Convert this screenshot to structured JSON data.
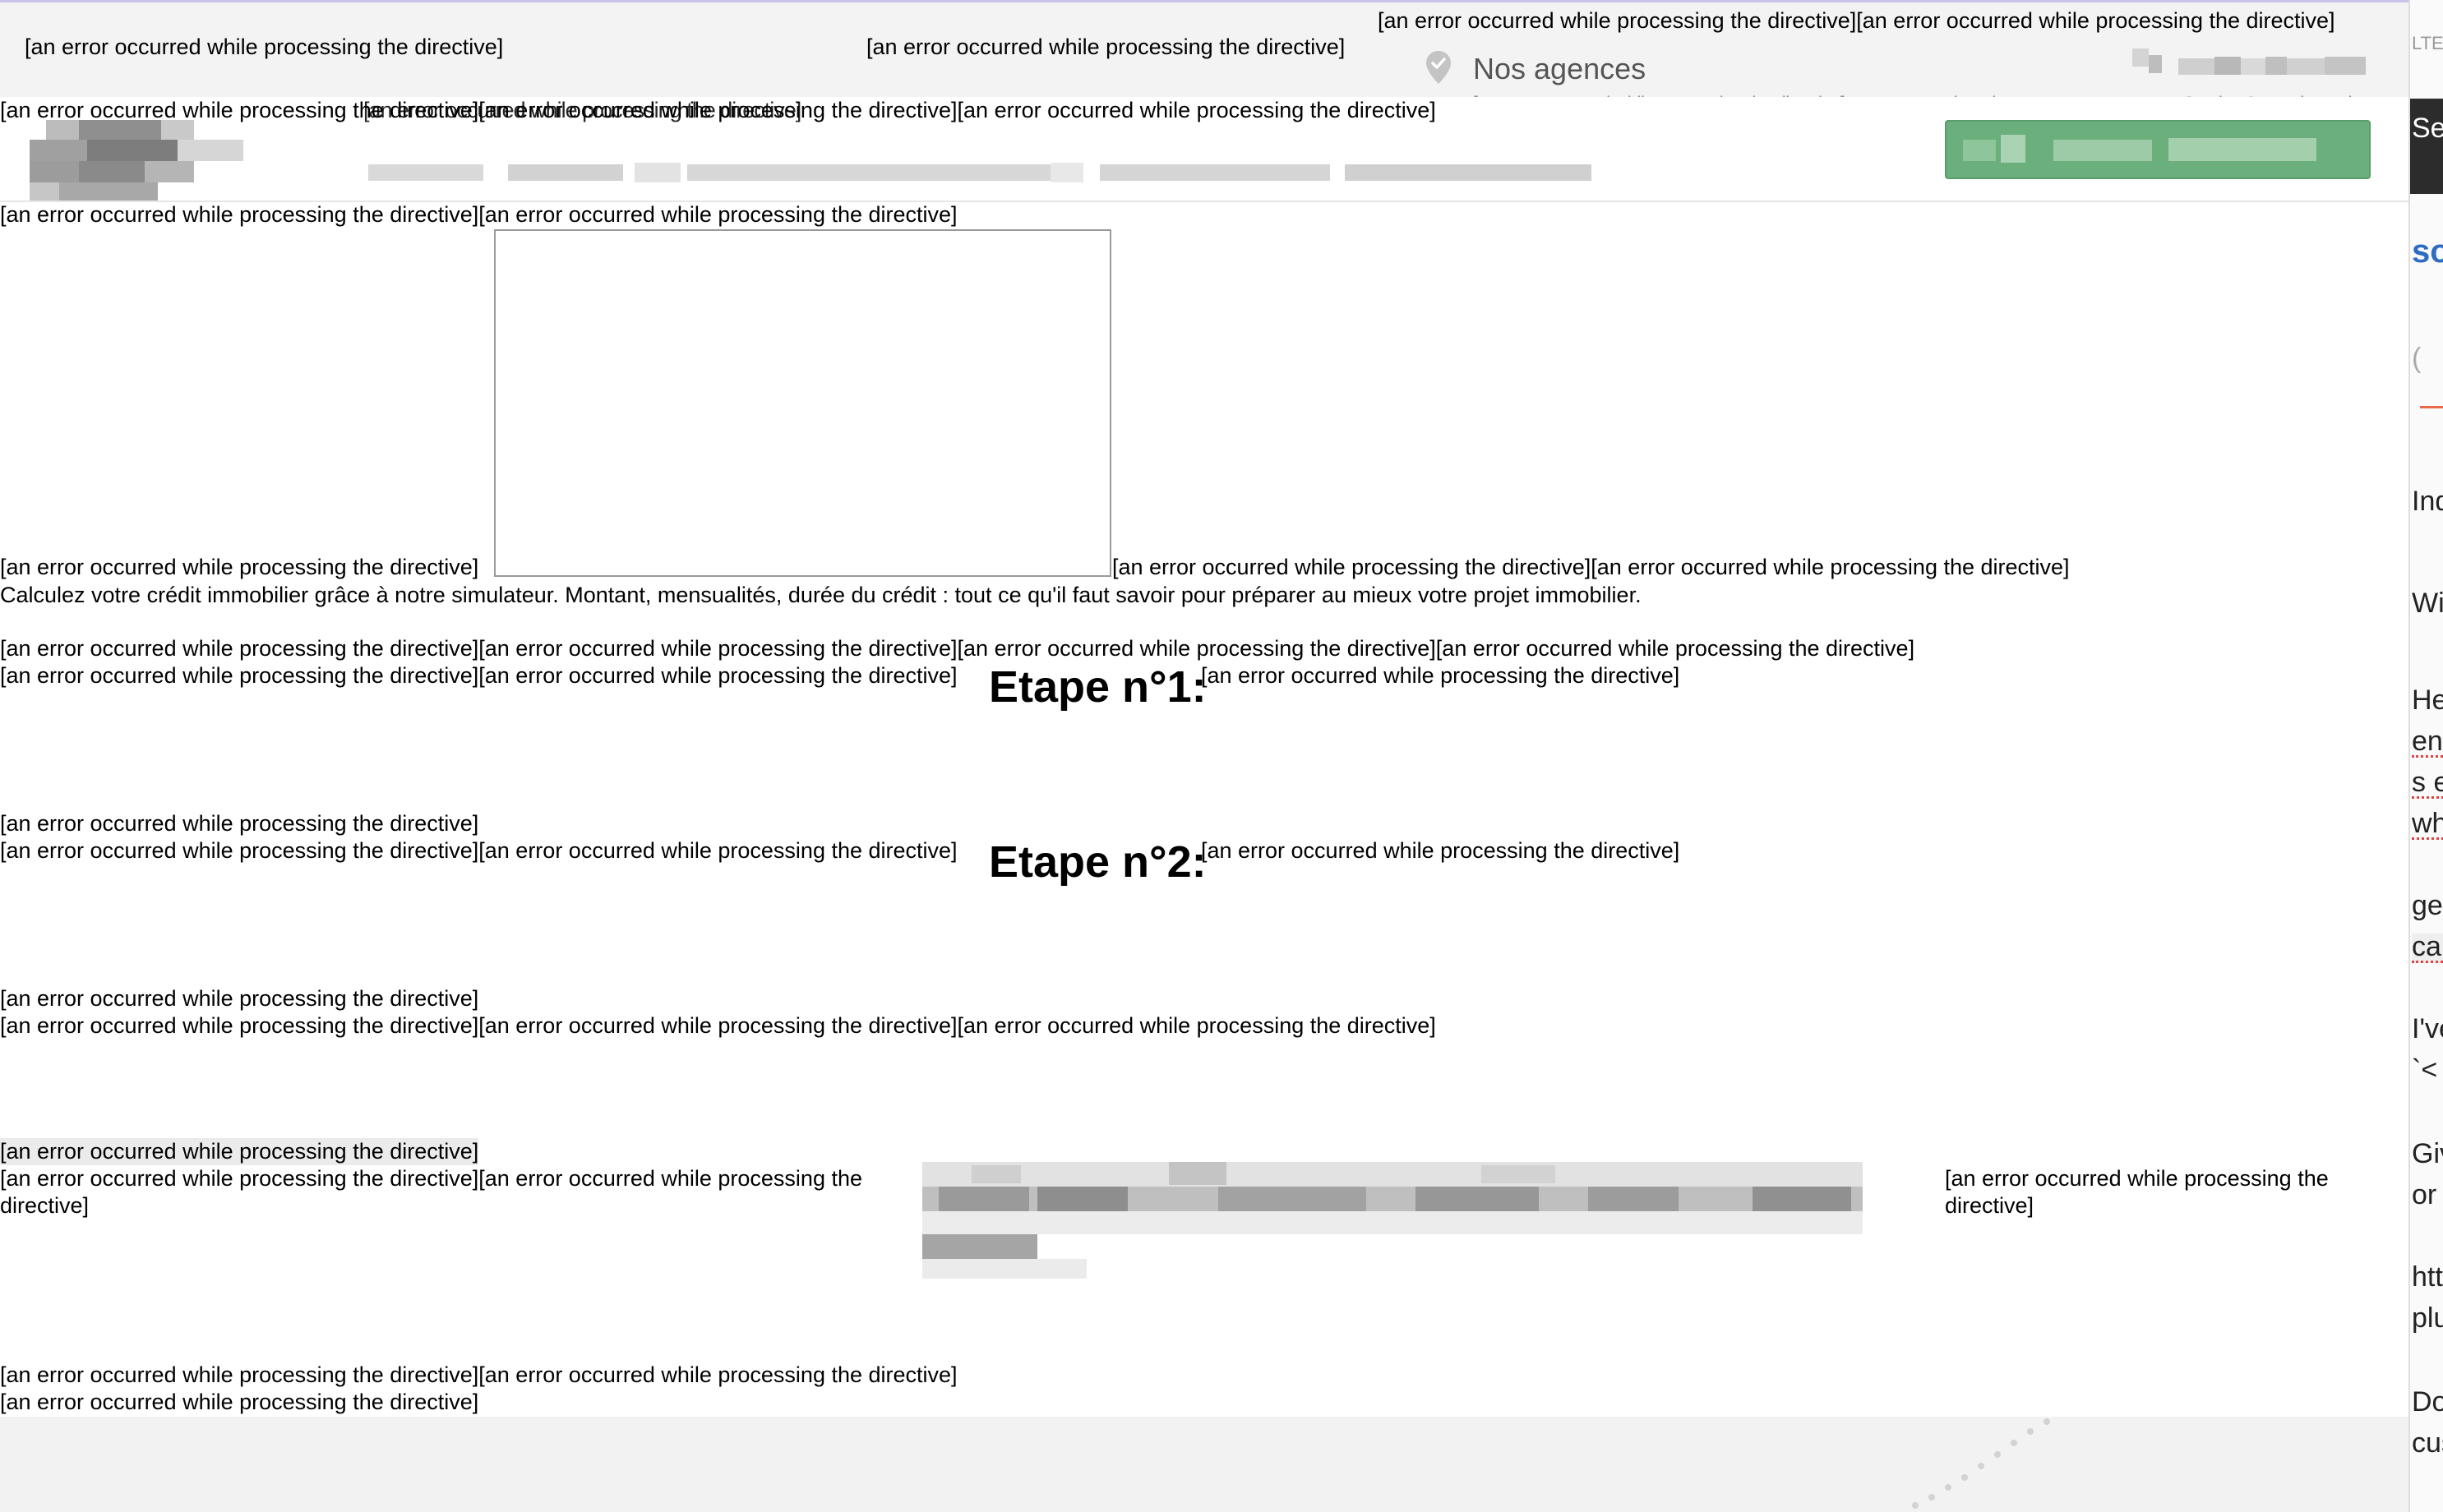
{
  "error_text": "[an error occurred while processing the directive]",
  "header": {
    "top_errors": {
      "left": "[an error occurred while processing the directive]",
      "center": "[an error occurred while processing the directive]",
      "right_pair": "[an error occurred while processing the directive][an error occurred while processing the directive]"
    },
    "agences": {
      "title": "Nos agences",
      "subtitle": "[an error occurred while processing the directive] agences proches de vous"
    },
    "service": {
      "subtitle": "Service & appel gratuit"
    },
    "nav_errors_line": "[an error occurred while processing the directive][an error occurred while processing the directive][an error occurred while processing the directive]",
    "nav_overlap_fragment": "[an error occurred while processing the directive]"
  },
  "content": {
    "row1": "[an error occurred while processing the directive][an error occurred while processing the directive]",
    "row2_left": "[an error occurred while processing the directive]",
    "row2_right": "[an error occurred while processing the directive][an error occurred while processing the directive]",
    "description": "Calculez votre crédit immobilier grâce à notre simulateur. Montant, mensualités, durée du crédit : tout ce qu'il faut savoir pour préparer au mieux votre projet immobilier.",
    "row3": "[an error occurred while processing the directive][an error occurred while processing the directive][an error occurred while processing the directive][an error occurred while processing the directive]",
    "step1": {
      "prefix": "[an error occurred while processing the directive][an error occurred while processing the directive]",
      "title": "Etape n°1:",
      "suffix": "[an error occurred while processing the directive]"
    },
    "row_after_step1": "[an error occurred while processing the directive]",
    "step2": {
      "prefix": "[an error occurred while processing the directive][an error occurred while processing the directive]",
      "title": "Etape n°2:",
      "suffix": "[an error occurred while processing the directive]"
    },
    "row_after_step2": "[an error occurred while processing the directive]",
    "row_triple": "[an error occurred while processing the directive][an error occurred while processing the directive][an error occurred while processing the directive]",
    "highlighted": "[an error occurred while processing the directive]",
    "row_pair_wrap_line1": "[an error occurred while processing the directive][an error occurred while processing the",
    "row_pair_wrap_line2": "directive]",
    "right_wrap_line1": "[an error occurred while processing the",
    "right_wrap_line2": "directive]",
    "bottom_pair": "[an error occurred while processing the directive][an error occurred while processing the directive]",
    "bottom_single": "[an error occurred while processing the directive]"
  },
  "sidebar": {
    "fragments": [
      "LTE",
      "Se",
      "sol",
      "Ind",
      "Wi",
      "Hel",
      "env",
      "s e",
      "whi",
      "ge",
      "can",
      "I've",
      "`<",
      "Giv",
      "or a",
      "http",
      "plug",
      "Do",
      "cus"
    ]
  },
  "colors": {
    "topbar_bg": "#f3f3f3",
    "cta_green": "#6bb07c",
    "accent_purple": "#c9c4ee",
    "link_blue": "#2d6cc0"
  },
  "icons": {
    "agences": "location-pin-icon"
  }
}
